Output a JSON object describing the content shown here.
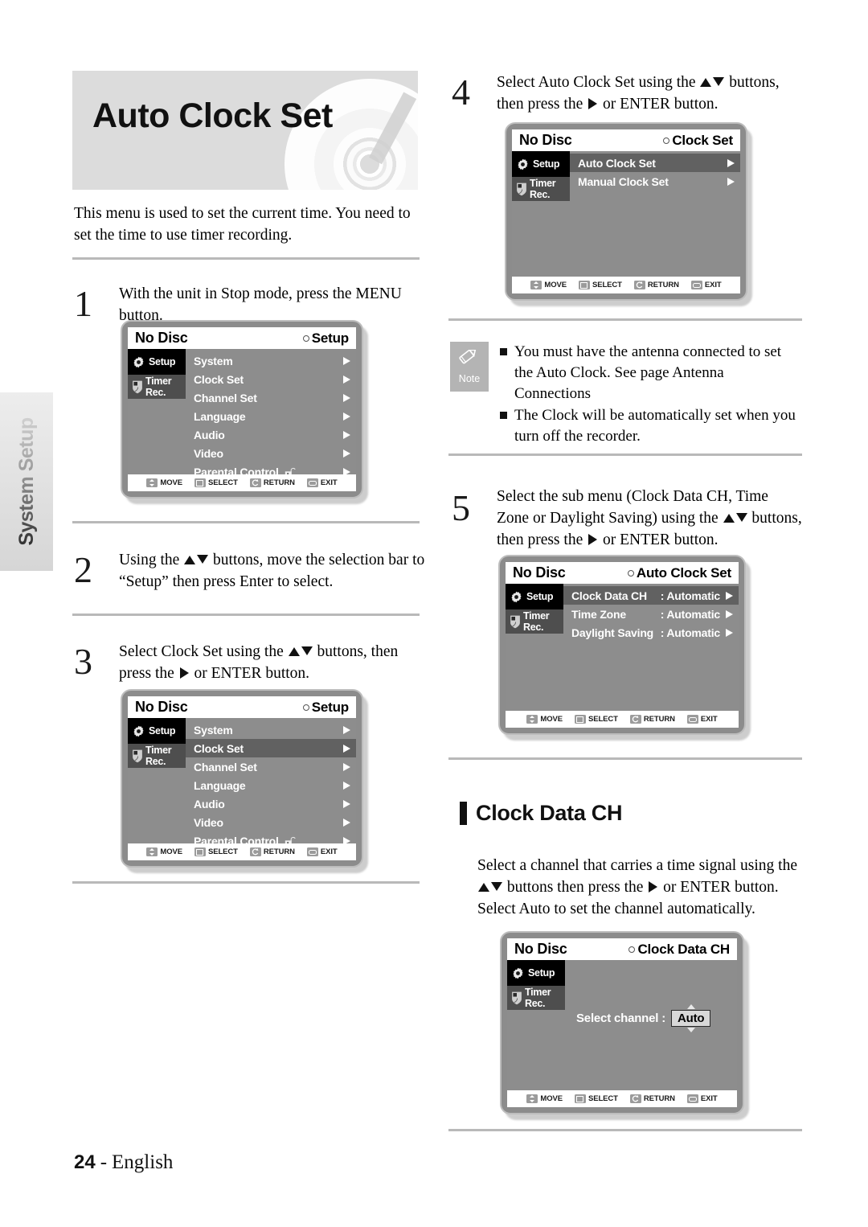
{
  "side_tab": {
    "label": "System Setup"
  },
  "banner": {
    "title": "Auto Clock Set",
    "disc_icon": "dvd-disc-icon"
  },
  "intro": "This menu is used to set the current time. You need to set the time to use timer recording.",
  "steps": [
    {
      "num": "1",
      "text_a": "With the unit in Stop mode, press the MENU button.",
      "text_b": ""
    },
    {
      "num": "2",
      "text_a": "Using the ",
      "text_b": " buttons, move the selection bar to “Setup” then press Enter to select."
    },
    {
      "num": "3",
      "text_a": "Select Clock Set using the ",
      "text_b": " buttons, then press the ",
      "text_c": " or ENTER button."
    },
    {
      "num": "4",
      "text_a": "Select Auto Clock Set using the ",
      "text_b": " buttons, then press the ",
      "text_c": " or ENTER button."
    },
    {
      "num": "5",
      "text_a": "Select the sub menu (Clock Data CH, Time Zone or Daylight Saving) using the ",
      "text_b": " buttons, then press the ",
      "text_c": " or ENTER button."
    }
  ],
  "osd_common": {
    "disc_label": "No Disc",
    "sidebar": {
      "setup": "Setup",
      "timer": "Timer Rec.",
      "setup_icon": "gear-icon",
      "timer_icon": "timer-record-icon"
    },
    "footer": [
      {
        "label": "MOVE",
        "icon": "updown-key-icon"
      },
      {
        "label": "SELECT",
        "icon": "enter-key-icon"
      },
      {
        "label": "RETURN",
        "icon": "return-key-icon"
      },
      {
        "label": "EXIT",
        "icon": "exit-key-icon"
      }
    ]
  },
  "osd_setup_menu": {
    "title": "Setup",
    "items": [
      {
        "label": "System",
        "selected": false,
        "lock": false
      },
      {
        "label": "Clock Set",
        "selected": false,
        "lock": false
      },
      {
        "label": "Channel Set",
        "selected": false,
        "lock": false
      },
      {
        "label": "Language",
        "selected": false,
        "lock": false
      },
      {
        "label": "Audio",
        "selected": false,
        "lock": false
      },
      {
        "label": "Video",
        "selected": false,
        "lock": false
      },
      {
        "label": "Parental Control",
        "selected": false,
        "lock": true
      }
    ]
  },
  "osd_setup_menu_clockset": {
    "title": "Setup",
    "items": [
      {
        "label": "System",
        "selected": false,
        "lock": false
      },
      {
        "label": "Clock Set",
        "selected": true,
        "lock": false
      },
      {
        "label": "Channel Set",
        "selected": false,
        "lock": false
      },
      {
        "label": "Language",
        "selected": false,
        "lock": false
      },
      {
        "label": "Audio",
        "selected": false,
        "lock": false
      },
      {
        "label": "Video",
        "selected": false,
        "lock": false
      },
      {
        "label": "Parental Control",
        "selected": false,
        "lock": true
      }
    ]
  },
  "osd_clock_set": {
    "title": "Clock Set",
    "items": [
      {
        "label": "Auto Clock Set",
        "selected": true,
        "lock": false
      },
      {
        "label": "Manual Clock Set",
        "selected": false,
        "lock": false
      }
    ]
  },
  "osd_auto_clock_set": {
    "title": "Auto Clock Set",
    "items": [
      {
        "label": "Clock Data CH",
        "value": ": Automatic",
        "selected": true
      },
      {
        "label": "Time Zone",
        "value": ": Automatic",
        "selected": false
      },
      {
        "label": "Daylight Saving",
        "value": ": Automatic",
        "selected": false
      }
    ]
  },
  "osd_clock_data_ch": {
    "title": "Clock Data CH",
    "select_channel_label": "Select channel :",
    "channel_value": "Auto"
  },
  "note": {
    "icon": "pencil-icon",
    "label": "Note",
    "items": [
      "You must have the antenna connected to set the Auto Clock. See page Antenna Connections",
      "The Clock will be automatically set when you turn off the recorder."
    ]
  },
  "section": {
    "title": "Clock Data CH",
    "body_a": "Select a channel that carries a time signal using the ",
    "body_b": " buttons then press the ",
    "body_c": " or ENTER button. Select Auto to set the channel automatically."
  },
  "footer": {
    "page": "24",
    "dash": "-",
    "language": "English"
  }
}
